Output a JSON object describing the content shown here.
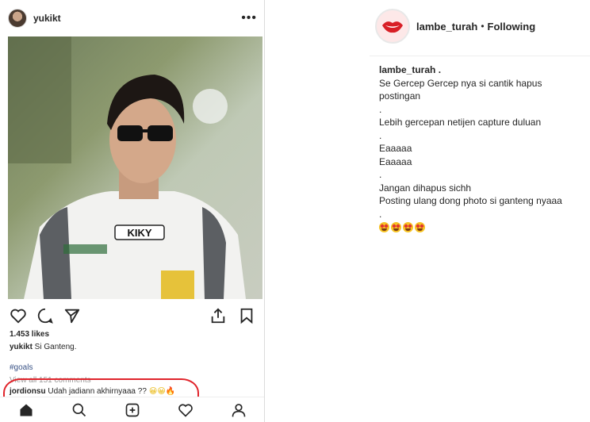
{
  "left_post": {
    "username": "yukikt",
    "more_label": "•••",
    "shirt_text": "KIKY",
    "likes": "1.453 likes",
    "caption_user": "yukikt",
    "caption_text": " Si Ganteng.",
    "hashtag": "#goals",
    "view_comments": "View all 151 comments",
    "comment_user": "jordionsu",
    "comment_text": " Udah jadiann akhirnyaaa ??",
    "comment_emoji": "😀😀🔥"
  },
  "right_post": {
    "username": "lambe_turah",
    "separator": "•",
    "follow_status": "Following",
    "caption_author": "lambe_turah .",
    "caption_lines": [
      "Se Gercep Gercep nya si cantik hapus postingan",
      ".",
      "Lebih gercepan netijen capture duluan",
      ".",
      "Eaaaaa",
      "Eaaaaa",
      ".",
      "Jangan dihapus sichh",
      "Posting ulang dong photo si ganteng nyaaa",
      "."
    ],
    "emoji_count": 4
  },
  "colors": {
    "highlight": "#e0242b",
    "link": "#385185",
    "muted": "#999999"
  },
  "icons": [
    "heart-icon",
    "comment-icon",
    "share-icon",
    "share-up-icon",
    "bookmark-icon",
    "home-icon",
    "search-icon",
    "add-icon",
    "activity-icon",
    "profile-icon"
  ]
}
